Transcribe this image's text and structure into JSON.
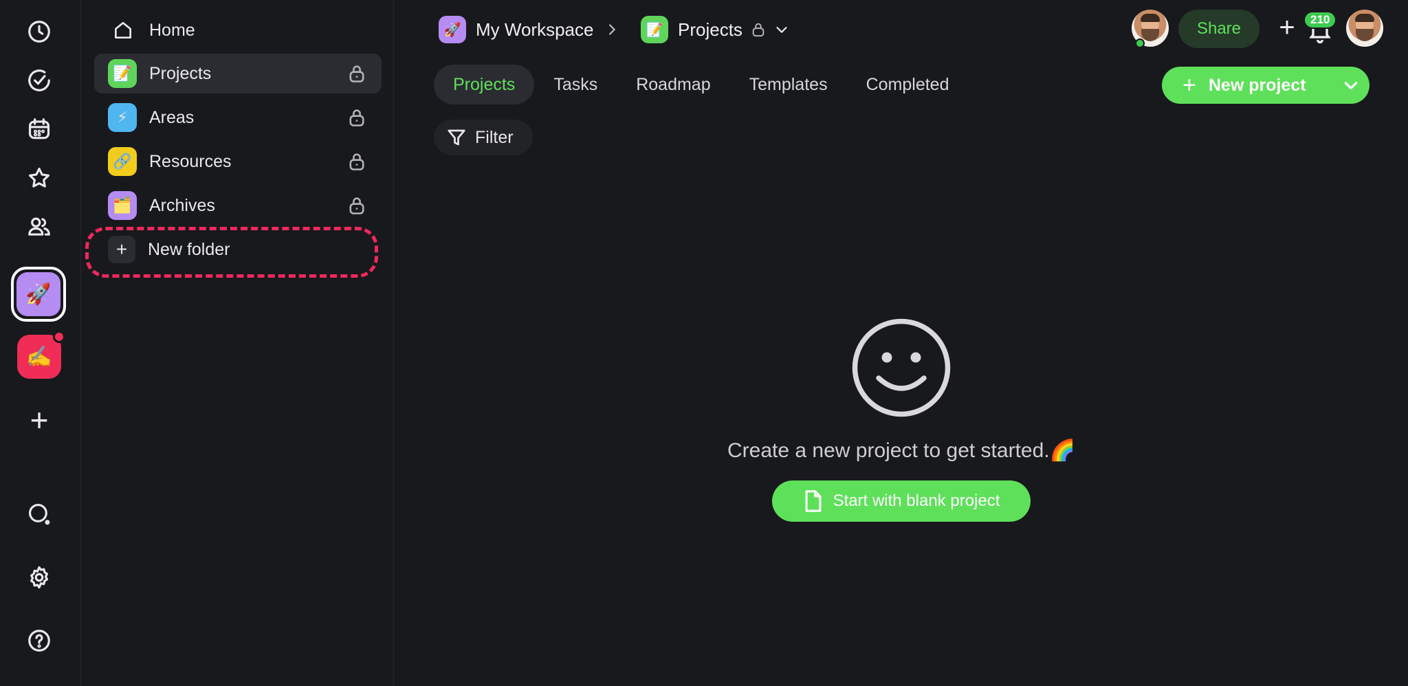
{
  "rail": {
    "icons": [
      "clock-icon",
      "check-circle-icon",
      "calendar-icon",
      "star-icon",
      "users-icon",
      "search-icon",
      "gear-icon",
      "help-icon"
    ],
    "workspace_emoji": "🚀",
    "workspace2_emoji": "✍️",
    "add_label": "+"
  },
  "sidebar": {
    "home_label": "Home",
    "items": [
      {
        "label": "Projects",
        "emoji": "📝",
        "color": "#5ed55a"
      },
      {
        "label": "Areas",
        "emoji": "⚡",
        "color": "#4fb6f0"
      },
      {
        "label": "Resources",
        "emoji": "🔗",
        "color": "#f2cc1d"
      },
      {
        "label": "Archives",
        "emoji": "🗂️",
        "color": "#b48cf2"
      }
    ],
    "new_folder_label": "New folder",
    "new_folder_plus": "+"
  },
  "header": {
    "workspace_name": "My Workspace",
    "workspace_emoji": "🚀",
    "project_name": "Projects",
    "project_emoji": "📝",
    "share_label": "Share",
    "plus_label": "+",
    "notification_count": "210"
  },
  "tabs": [
    "Projects",
    "Tasks",
    "Roadmap",
    "Templates",
    "Completed"
  ],
  "filter_label": "Filter",
  "new_project": {
    "plus": "+",
    "label": "New project"
  },
  "empty_state": {
    "message": "Create a new project to get started.🌈",
    "button_label": "Start with blank project"
  },
  "colors": {
    "accent": "#5ee05a",
    "highlight": "#f0285e",
    "background": "#18191c"
  }
}
